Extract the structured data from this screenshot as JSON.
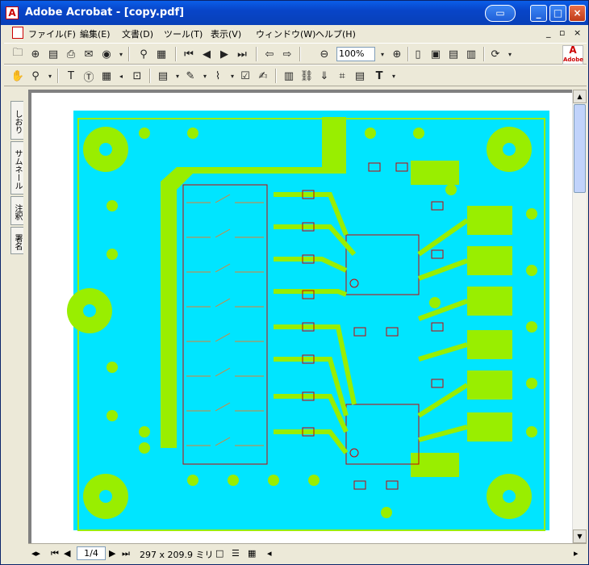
{
  "window": {
    "title": "Adobe Acrobat - [copy.pdf]",
    "controls": [
      "minimize",
      "maximize",
      "close"
    ]
  },
  "menu": {
    "items": [
      "ファイル(F)",
      "編集(E)",
      "文書(D)",
      "ツール(T)",
      "表示(V)",
      "ウィンドウ(W)",
      "ヘルプ(H)"
    ],
    "mdi": [
      "_",
      "▫",
      "×"
    ]
  },
  "toolbar1": {
    "zoom_value": "100%"
  },
  "toolbar2": {
    "text_tool": "T"
  },
  "adobe_logo": "Adobe",
  "side_tabs": [
    "しおり",
    "サムネール",
    "注釈",
    "署名"
  ],
  "status": {
    "page": "1/4",
    "page_size": "297 x 209.9 ミリ"
  },
  "colors": {
    "titlebar": "#0a5ee8",
    "board_cyan": "#00e5ff",
    "pad_green": "#99ee00",
    "trace_red": "#cc0000",
    "trace_orange": "#e08030"
  }
}
